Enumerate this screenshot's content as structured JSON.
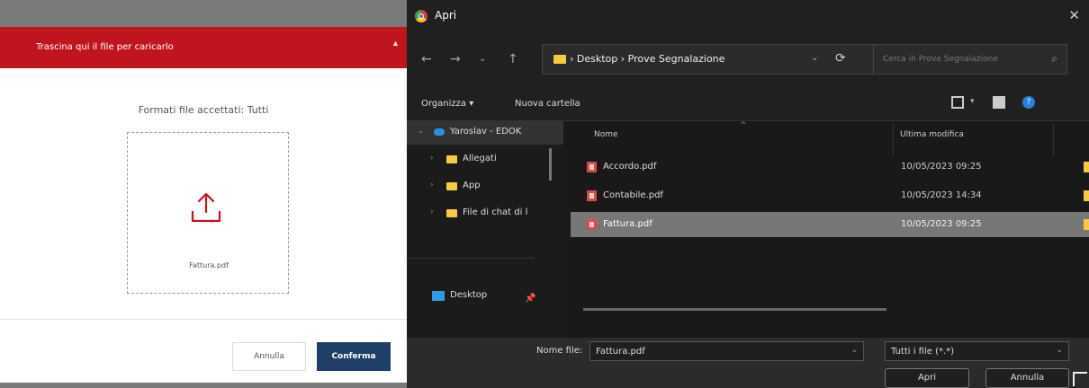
{
  "upload_modal": {
    "header_title": "Trascina qui il file per caricarlo",
    "formats_text": "Formati file accettati: Tutti",
    "file_name": "Fattura.pdf",
    "cancel_label": "Annulla",
    "confirm_label": "Conferma",
    "colors": {
      "header": "#c0151f",
      "confirm": "#1f3f67"
    }
  },
  "dialog": {
    "title": "Apri",
    "breadcrumb": "›  Desktop  ›  Prove Segnalazione",
    "search_placeholder": "Cerca in Prove Segnalazione",
    "toolbar": {
      "organize": "Organizza ▾",
      "new_folder": "Nuova cartella"
    },
    "nav_items": [
      {
        "label": "Yaroslav - EDOK",
        "icon": "cloud-icon"
      },
      {
        "label": "Allegati",
        "icon": "folder-icon"
      },
      {
        "label": "App",
        "icon": "folder-icon"
      },
      {
        "label": "File di chat di l",
        "icon": "folder-icon"
      },
      {
        "label": "Desktop",
        "icon": "desktop-icon"
      }
    ],
    "columns": {
      "name": "Nome",
      "modified": "Ultima modifica"
    },
    "files": [
      {
        "name": "Accordo.pdf",
        "modified": "10/05/2023 09:25"
      },
      {
        "name": "Contabile.pdf",
        "modified": "10/05/2023 14:34"
      },
      {
        "name": "Fattura.pdf",
        "modified": "10/05/2023 09:25",
        "selected": true
      }
    ],
    "filename_label": "Nome file:",
    "filename_value": "Fattura.pdf",
    "filetype_value": "Tutti i file (*.*)",
    "open_label": "Apri",
    "cancel_label": "Annulla"
  }
}
